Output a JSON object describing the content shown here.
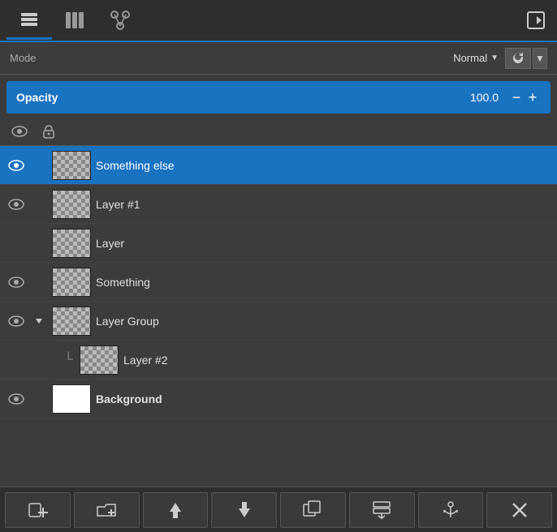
{
  "toolbar": {
    "tabs": [
      {
        "id": "layers",
        "label": "layers",
        "active": true
      },
      {
        "id": "channels",
        "label": "channels"
      },
      {
        "id": "paths",
        "label": "paths"
      }
    ],
    "corner_btn": "corner"
  },
  "mode_row": {
    "label": "Mode",
    "value": "Normal",
    "refresh_label": "↺",
    "dropdown_arrow": "▼"
  },
  "opacity_row": {
    "label": "Opacity",
    "value": "100.0",
    "minus": "−",
    "plus": "+"
  },
  "visibility_row": {
    "eye_title": "Toggle visibility",
    "lock_title": "Lock"
  },
  "layers": [
    {
      "id": "something-else",
      "name": "Something else",
      "active": true,
      "visible": true,
      "thumb_type": "checker",
      "indent": false,
      "expand": false
    },
    {
      "id": "layer-1",
      "name": "Layer #1",
      "active": false,
      "visible": false,
      "thumb_type": "checker",
      "indent": false,
      "expand": false
    },
    {
      "id": "layer",
      "name": "Layer",
      "active": false,
      "visible": false,
      "thumb_type": "checker",
      "indent": false,
      "expand": false
    },
    {
      "id": "something",
      "name": "Something",
      "active": false,
      "visible": true,
      "thumb_type": "checker",
      "indent": false,
      "expand": false
    },
    {
      "id": "layer-group",
      "name": "Layer Group",
      "active": false,
      "visible": true,
      "thumb_type": "checker",
      "indent": false,
      "expand": true,
      "expanded": true
    },
    {
      "id": "layer-2",
      "name": "Layer #2",
      "active": false,
      "visible": false,
      "thumb_type": "checker",
      "indent": true,
      "expand": false
    },
    {
      "id": "background",
      "name": "Background",
      "active": false,
      "visible": true,
      "thumb_type": "white",
      "indent": false,
      "expand": false
    }
  ],
  "bottom_toolbar": {
    "buttons": [
      {
        "id": "new-layer",
        "icon": "new-layer-icon",
        "label": "+"
      },
      {
        "id": "new-group",
        "icon": "new-group-icon",
        "label": "📁+"
      },
      {
        "id": "move-up",
        "icon": "up-icon",
        "label": "↑"
      },
      {
        "id": "move-down",
        "icon": "down-icon",
        "label": "↓"
      },
      {
        "id": "duplicate",
        "icon": "duplicate-icon",
        "label": "⧉"
      },
      {
        "id": "merge",
        "icon": "merge-icon",
        "label": "⤵"
      },
      {
        "id": "anchor",
        "icon": "anchor-icon",
        "label": "⚓"
      },
      {
        "id": "delete",
        "icon": "delete-icon",
        "label": "✕"
      }
    ]
  },
  "colors": {
    "active_blue": "#1a73c1",
    "bg_dark": "#2e2e2e",
    "bg_mid": "#3c3c3c",
    "text_light": "#e0e0e0",
    "text_muted": "#aaaaaa"
  }
}
